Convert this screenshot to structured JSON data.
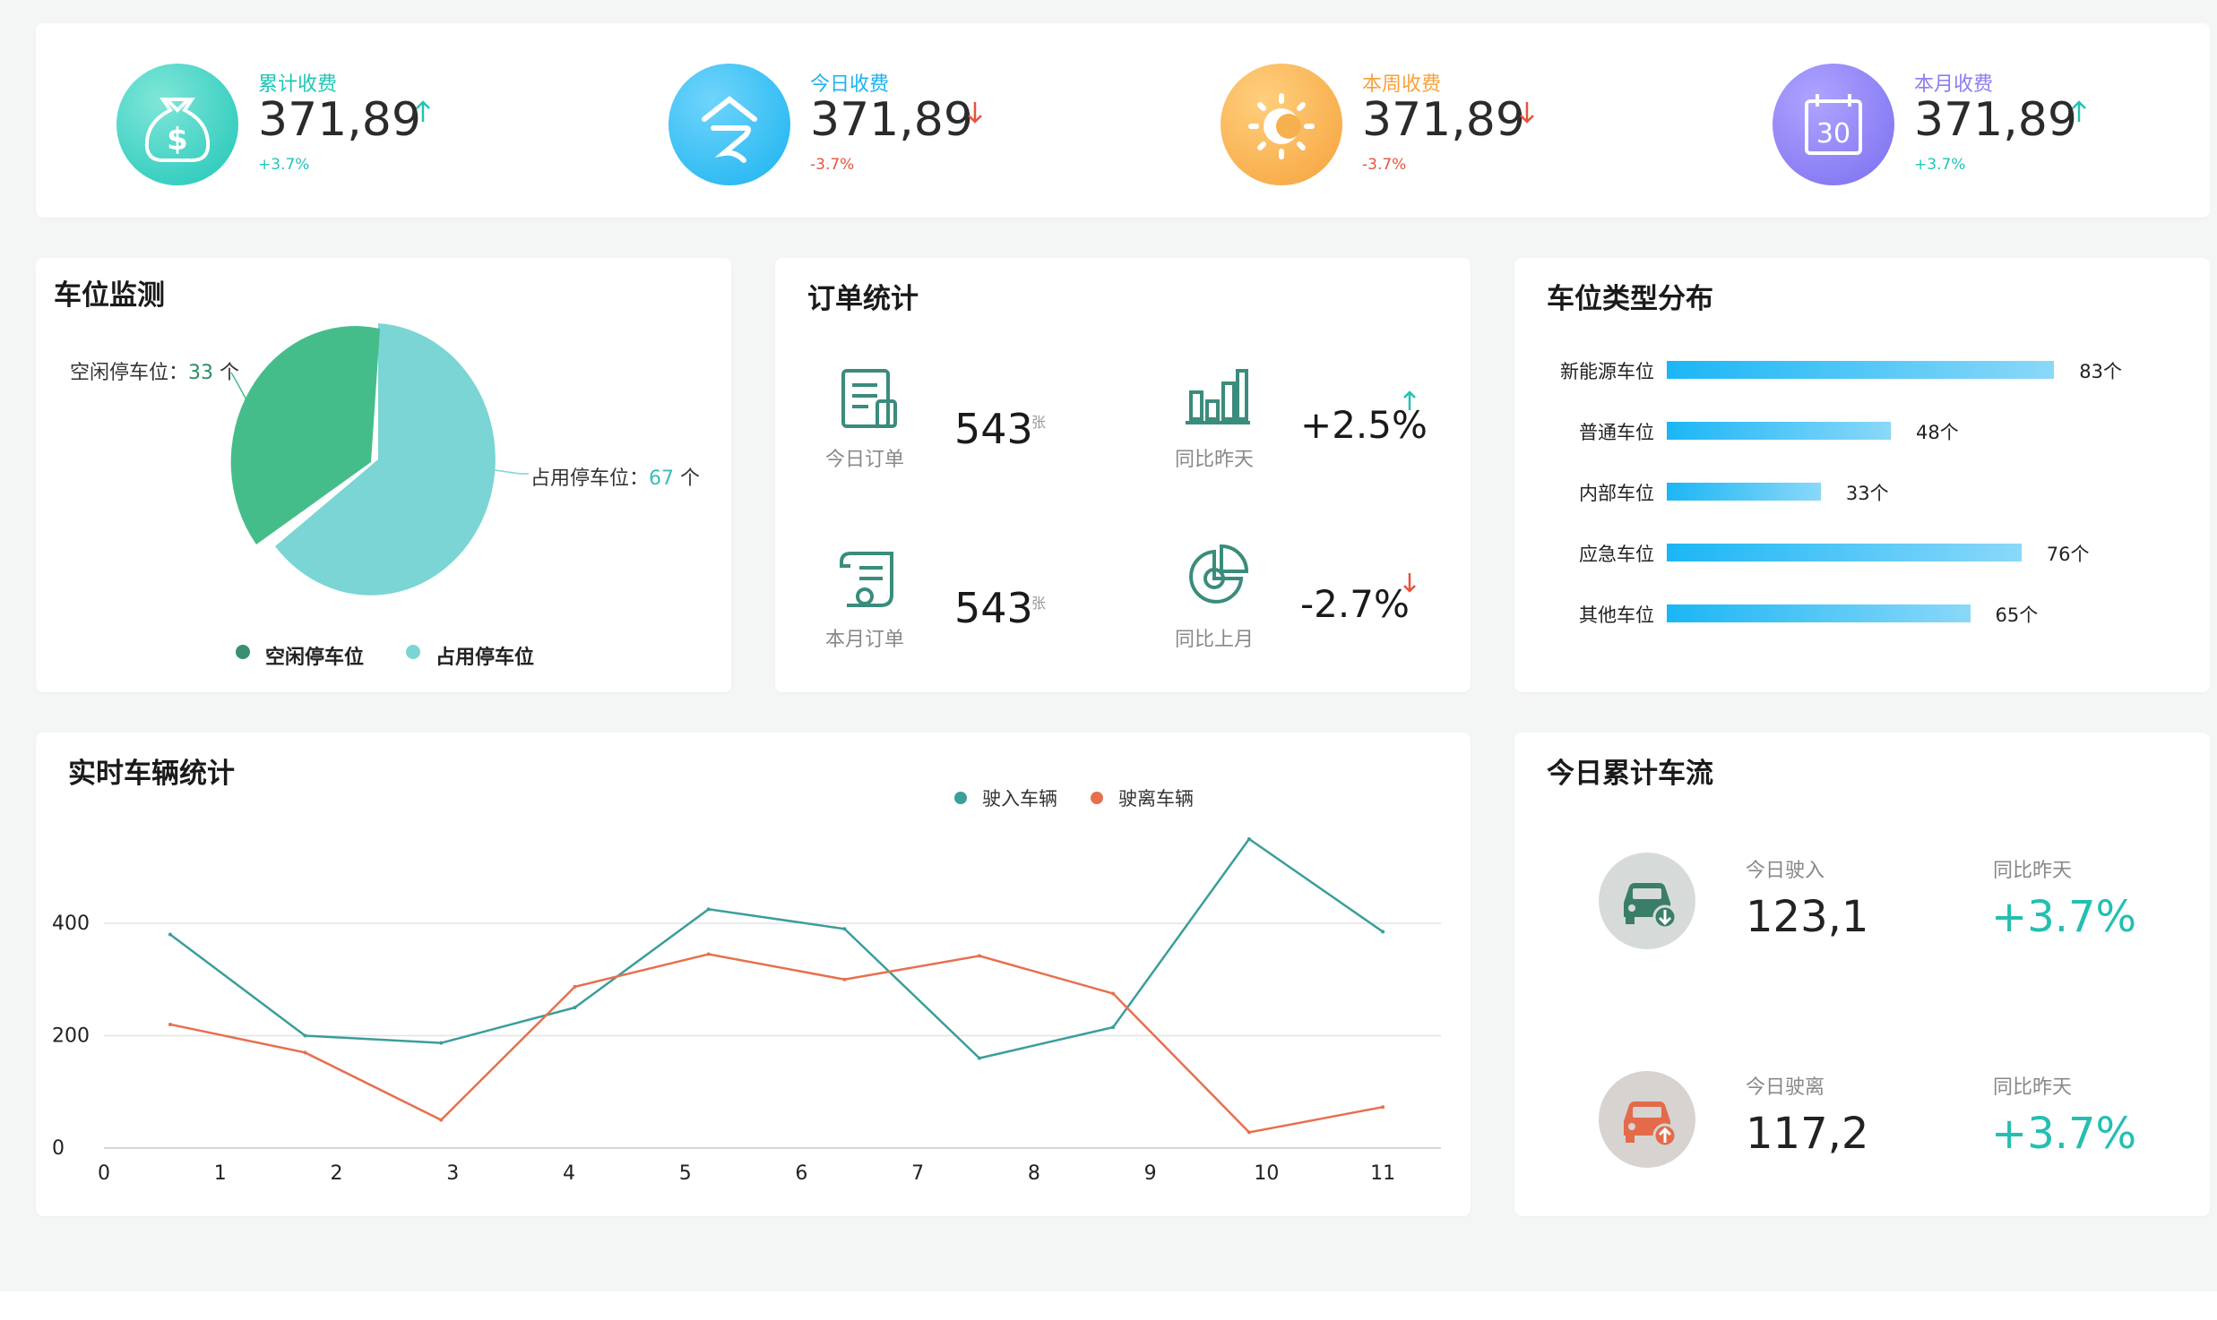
{
  "colors": {
    "teal": "#23c2b4",
    "blue": "#1ab3f0",
    "orange": "#f5a23c",
    "purple": "#8a7df0",
    "up": "#23c2b4",
    "down": "#e6533c",
    "pie_free": "#45bd8a",
    "pie_used": "#7ad5d4",
    "line_in": "#3a9e9a",
    "line_out": "#e86f4e"
  },
  "stats": [
    {
      "label": "累计收费",
      "value": "371,89",
      "change": "+3.7%",
      "trend": "up",
      "icon": "money-bag-icon",
      "color": "#1fc6b8"
    },
    {
      "label": "今日收费",
      "value": "371,89",
      "change": "-3.7%",
      "trend": "down",
      "icon": "today-icon",
      "color": "#1ab3f0"
    },
    {
      "label": "本周收费",
      "value": "371,89",
      "change": "-3.7%",
      "trend": "down",
      "icon": "sun-icon",
      "color": "#f5a23c"
    },
    {
      "label": "本月收费",
      "value": "371,89",
      "change": "+3.7%",
      "trend": "up",
      "icon": "calendar-icon",
      "color": "#8a7df0",
      "calendar_day": "30"
    }
  ],
  "parking_monitor": {
    "title": "车位监测",
    "free": {
      "label": "空闲停车位：",
      "value": "33",
      "unit": " 个"
    },
    "used": {
      "label": "占用停车位：",
      "value": "67",
      "unit": " 个"
    },
    "legend": [
      "空闲停车位",
      "占用停车位"
    ]
  },
  "orders": {
    "title": "订单统计",
    "today": {
      "label": "今日订单",
      "value": "543",
      "unit": "张"
    },
    "month": {
      "label": "本月订单",
      "value": "543",
      "unit": "张"
    },
    "vs_yesterday": {
      "label": "同比昨天",
      "value": "+2.5%",
      "trend": "up"
    },
    "vs_last_month": {
      "label": "同比上月",
      "value": "-2.7%",
      "trend": "down"
    }
  },
  "space_types": {
    "title": "车位类型分布",
    "items": [
      {
        "label": "新能源车位",
        "value": 83,
        "text": "83个"
      },
      {
        "label": "普通车位",
        "value": 48,
        "text": "48个"
      },
      {
        "label": "内部车位",
        "value": 33,
        "text": "33个"
      },
      {
        "label": "应急车位",
        "value": 76,
        "text": "76个"
      },
      {
        "label": "其他车位",
        "value": 65,
        "text": "65个"
      }
    ],
    "max": 90
  },
  "realtime": {
    "title": "实时车辆统计"
  },
  "chart_data": {
    "type": "line",
    "x_ticks": [
      "0",
      "1",
      "2",
      "3",
      "4",
      "5",
      "6",
      "7",
      "8",
      "9",
      "10",
      "11"
    ],
    "y_ticks": [
      "0",
      "200",
      "400"
    ],
    "xlim": [
      0,
      11.5
    ],
    "ylim": [
      0,
      400
    ],
    "legend_position": "top-center",
    "series": [
      {
        "name": "驶入车辆",
        "color": "#3a9e9a",
        "x": [
          0.57,
          1.73,
          2.9,
          4.05,
          5.2,
          6.37,
          7.53,
          8.68,
          9.85,
          11.0
        ],
        "values": [
          380,
          200,
          187,
          250,
          425,
          390,
          160,
          215,
          550,
          385
        ]
      },
      {
        "name": "驶离车辆",
        "color": "#e86f4e",
        "x": [
          0.57,
          1.73,
          2.9,
          4.05,
          5.2,
          6.37,
          7.53,
          8.68,
          9.85,
          11.0
        ],
        "values": [
          220,
          170,
          50,
          287,
          345,
          300,
          342,
          275,
          28,
          73
        ]
      }
    ]
  },
  "flow": {
    "title": "今日累计车流",
    "in": {
      "label": "今日驶入",
      "value": "123,1",
      "cmp_label": "同比昨天",
      "cmp_value": "+3.7%"
    },
    "out": {
      "label": "今日驶离",
      "value": "117,2",
      "cmp_label": "同比昨天",
      "cmp_value": "+3.7%"
    }
  }
}
